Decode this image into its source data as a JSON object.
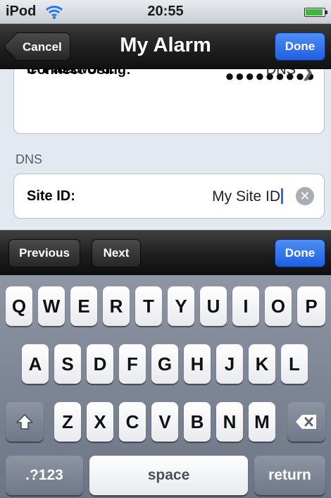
{
  "status_bar": {
    "carrier": "iPod",
    "time": "20:55"
  },
  "nav": {
    "title": "My Alarm",
    "cancel_label": "Cancel",
    "done_label": "Done"
  },
  "form": {
    "password_label": "IP Password:",
    "password_dots": "●●●●●●●●●",
    "connect_label": "Connect Using:",
    "connect_value": "DNS",
    "section_dns": "DNS",
    "site_id_label": "Site ID:",
    "site_id_value": "My Site ID"
  },
  "toolbar": {
    "previous_label": "Previous",
    "next_label": "Next",
    "done_label": "Done"
  },
  "keyboard": {
    "row1": [
      "Q",
      "W",
      "E",
      "R",
      "T",
      "Y",
      "U",
      "I",
      "O",
      "P"
    ],
    "row2": [
      "A",
      "S",
      "D",
      "F",
      "G",
      "H",
      "J",
      "K",
      "L"
    ],
    "row3": [
      "Z",
      "X",
      "C",
      "V",
      "B",
      "N",
      "M"
    ],
    "numbers_label": ".?123",
    "space_label": "space",
    "return_label": "return"
  },
  "icons": [
    "wifi-icon",
    "battery-icon",
    "chevron-right-icon",
    "clear-icon",
    "shift-icon",
    "backspace-icon"
  ],
  "colors": {
    "nav_bar": "#1f1f1f",
    "done_blue": "#1f5fe0",
    "background": "#e3e9f1",
    "keyboard": "#7d8695",
    "battery_green": "#3ab93a"
  }
}
